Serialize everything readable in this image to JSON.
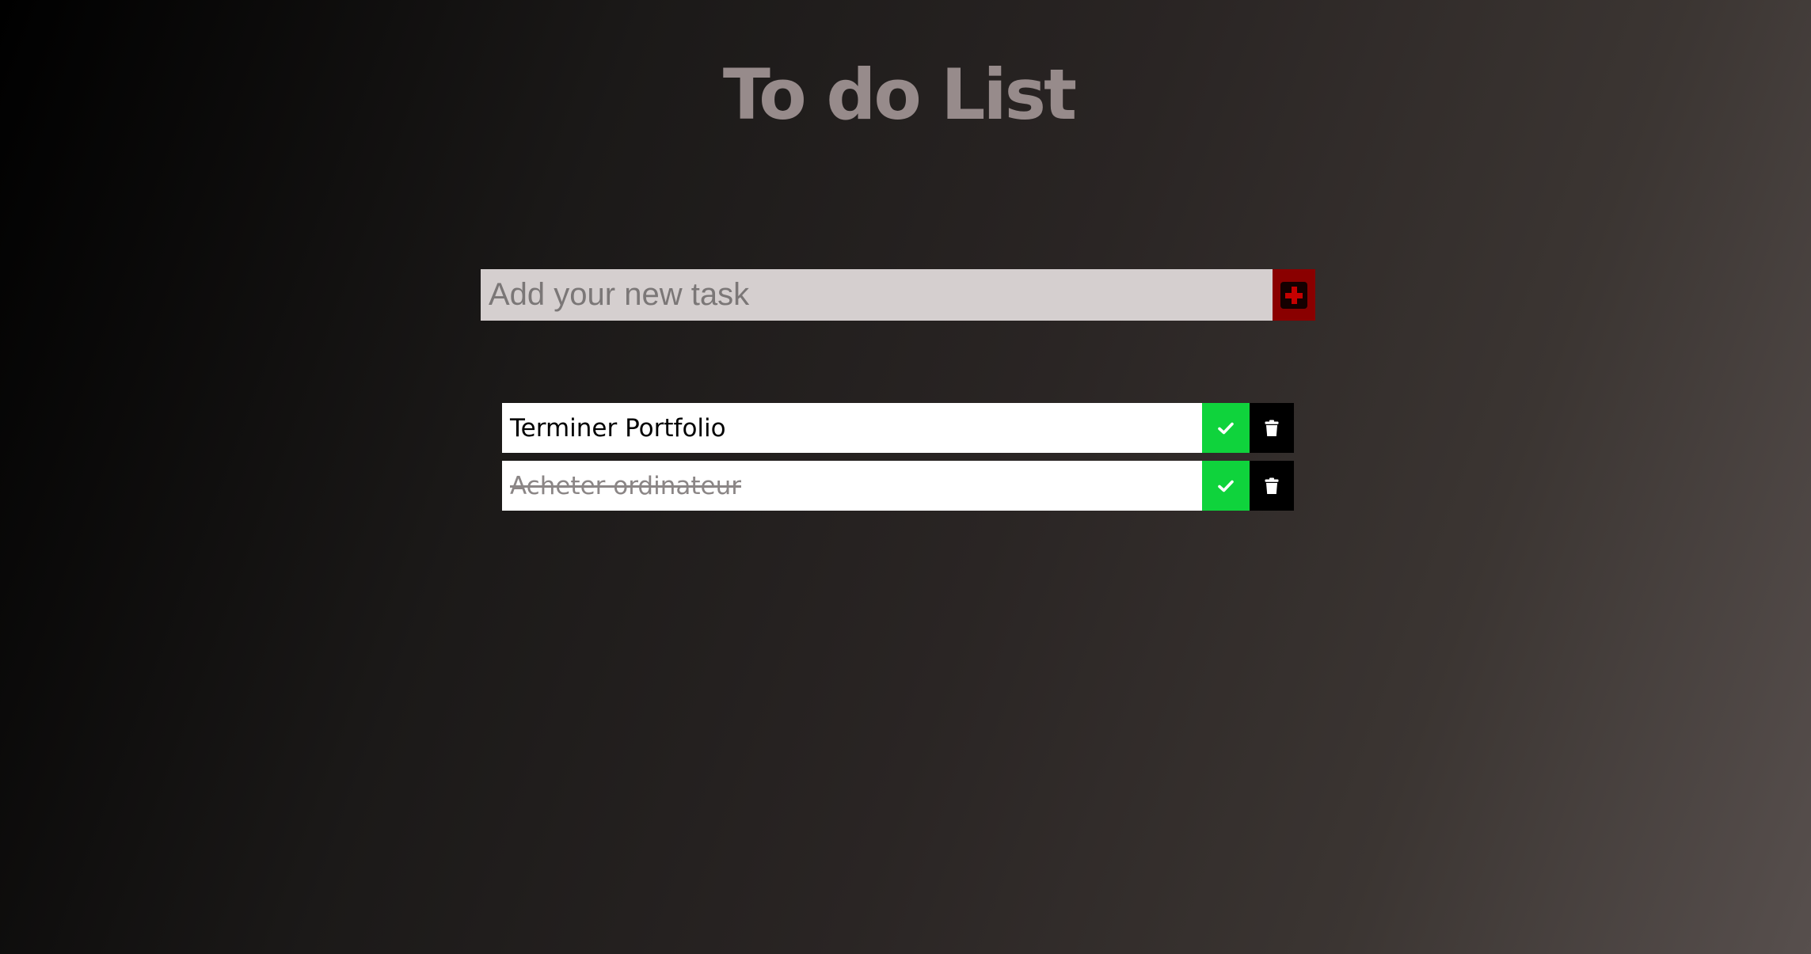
{
  "app": {
    "title": "To do List"
  },
  "add_form": {
    "placeholder": "Add your new task",
    "value": "",
    "add_icon": "plus-square-icon"
  },
  "tasks": [
    {
      "text": "Terminer Portfolio",
      "completed": false
    },
    {
      "text": "Acheter ordinateur",
      "completed": true
    }
  ],
  "icons": {
    "complete": "check-icon",
    "delete": "trash-icon"
  },
  "colors": {
    "title": "#978b8b",
    "input_background": "#d5cfcf",
    "add_button": "#8a0000",
    "check_button": "#0fd33c",
    "trash_button": "#000000"
  }
}
